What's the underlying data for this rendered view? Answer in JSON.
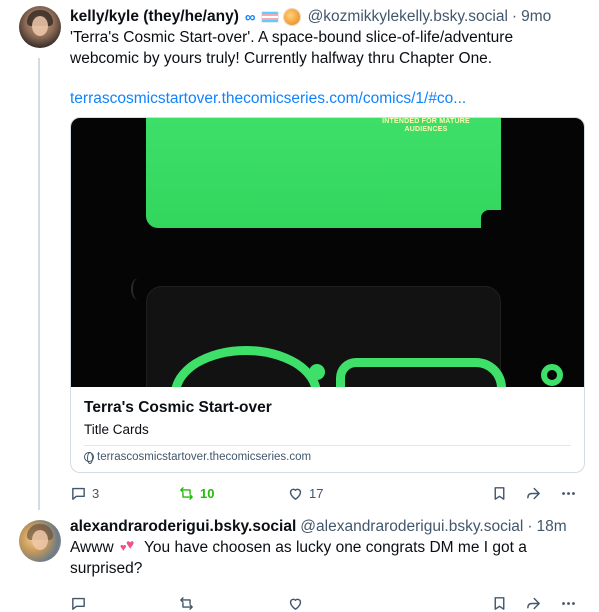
{
  "posts": [
    {
      "author": {
        "display_name": "kelly/kyle (they/he/any)",
        "badge_symbol": "∞",
        "handle": "@kozmikkylekelly.bsky.social",
        "time": "9mo"
      },
      "text": "'Terra's Cosmic Start-over'. A space-bound slice-of-life/adventure webcomic by yours truly! Currently halfway thru Chapter One.",
      "link": "terrascosmicstartover.thecomicseries.com/comics/1/#co...",
      "card": {
        "image_text": "INTENDED FOR MATURE AUDIENCES",
        "title": "Terra's Cosmic Start-over",
        "description": "Title Cards",
        "domain": "terrascosmicstartover.thecomicseries.com"
      },
      "actions": {
        "replies": "3",
        "reposts": "10",
        "likes": "17"
      }
    },
    {
      "author": {
        "display_name": "alexandraroderigui.bsky.social",
        "handle": "@alexandraroderigui.bsky.social",
        "time": "18m"
      },
      "text_before": "Awww",
      "text_after": "You have choosen as lucky one congrats DM me I got a surprised?",
      "actions": {
        "replies": "",
        "reposts": "",
        "likes": ""
      }
    }
  ],
  "colors": {
    "link": "#1083fe",
    "muted": "#42576c",
    "repost_active": "#20bc07",
    "accent_green": "#3ee06a"
  },
  "icons": [
    "reply-icon",
    "repost-icon",
    "like-icon",
    "bookmark-icon",
    "share-icon",
    "more-icon",
    "globe-icon",
    "trans-flag-icon",
    "planet-emoji-icon",
    "hearts-emoji-icon"
  ]
}
